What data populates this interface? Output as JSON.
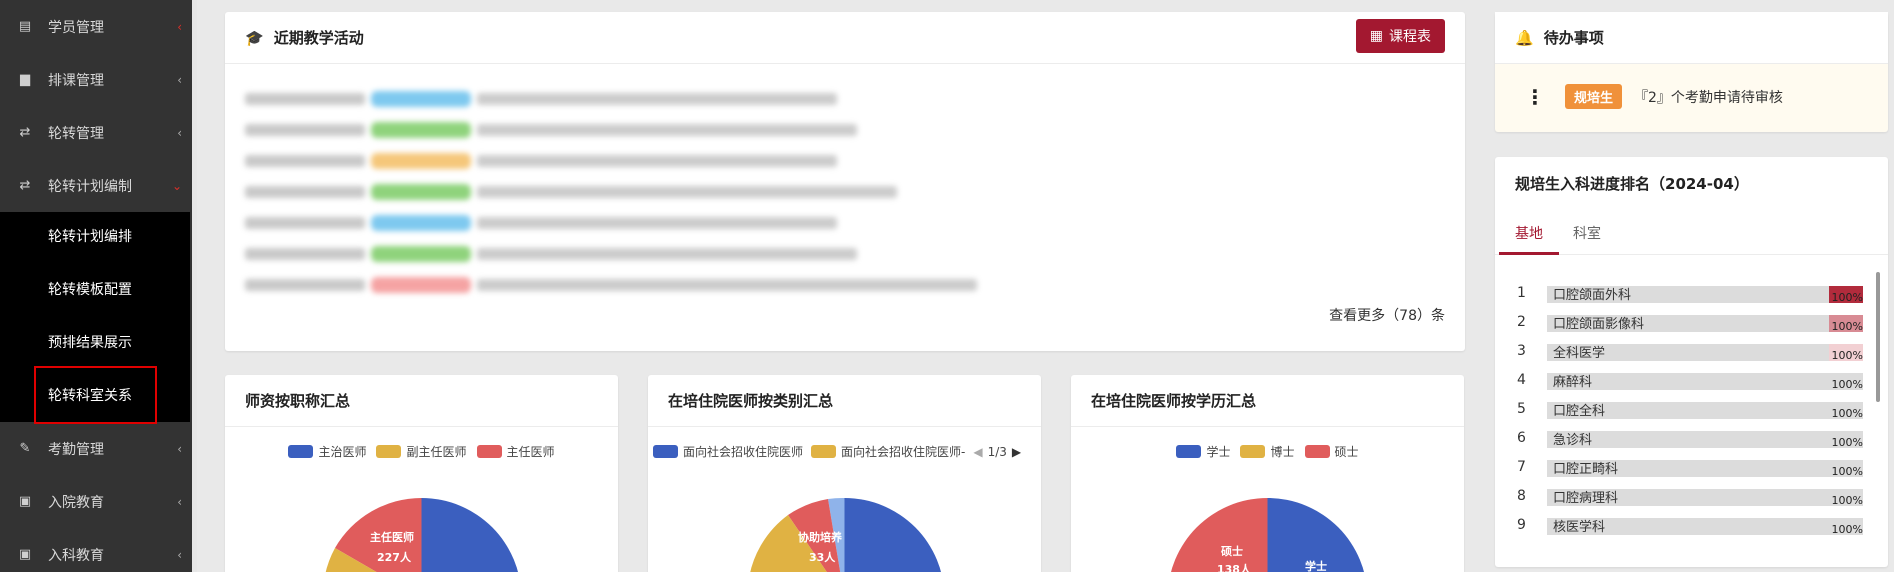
{
  "sidebar": {
    "items": [
      {
        "label": "学员管理",
        "icon": "id-card-icon",
        "arrow_open": true
      },
      {
        "label": "排课管理",
        "icon": "document-icon",
        "arrow_open": false
      },
      {
        "label": "轮转管理",
        "icon": "rotate-icon",
        "arrow_open": false
      },
      {
        "label": "轮转计划编制",
        "icon": "rotate-icon",
        "arrow_open": true
      }
    ],
    "subitems": [
      "轮转计划编排",
      "轮转模板配置",
      "预排结果展示",
      "轮转科室关系"
    ],
    "bottom_items": [
      {
        "label": "考勤管理",
        "icon": "brush-icon"
      },
      {
        "label": "入院教育",
        "icon": "clipboard-icon"
      },
      {
        "label": "入科教育",
        "icon": "clipboard-icon"
      }
    ]
  },
  "recent": {
    "title": "近期教学活动",
    "timetable_label": "课程表",
    "more_label": "查看更多（78）条",
    "blur_colors": [
      "#7ec9ef",
      "#8fd37c",
      "#f5c77a",
      "#8fd37c",
      "#7ec9ef",
      "#8fd37c",
      "#f5a3a3"
    ]
  },
  "todo": {
    "title": "待办事项",
    "badge": "规培生",
    "text": "『2』个考勤申请待审核"
  },
  "ranking": {
    "title": "规培生入科进度排名（2024-04）",
    "tabs": [
      "基地",
      "科室"
    ],
    "rows": [
      {
        "no": "1",
        "name": "口腔颌面外科",
        "pct": "100%",
        "color": "#b22b3c"
      },
      {
        "no": "2",
        "name": "口腔颌面影像科",
        "pct": "100%",
        "color": "#d88b94"
      },
      {
        "no": "3",
        "name": "全科医学",
        "pct": "100%",
        "color": "#f2d0d3"
      },
      {
        "no": "4",
        "name": "麻醉科",
        "pct": "100%",
        "color": "#dcdcdc"
      },
      {
        "no": "5",
        "name": "口腔全科",
        "pct": "100%",
        "color": "#dcdcdc"
      },
      {
        "no": "6",
        "name": "急诊科",
        "pct": "100%",
        "color": "#dcdcdc"
      },
      {
        "no": "7",
        "name": "口腔正畸科",
        "pct": "100%",
        "color": "#dcdcdc"
      },
      {
        "no": "8",
        "name": "口腔病理科",
        "pct": "100%",
        "color": "#dcdcdc"
      },
      {
        "no": "9",
        "name": "核医学科",
        "pct": "100%",
        "color": "#dcdcdc"
      }
    ]
  },
  "charts": {
    "teacher": {
      "title": "师资按职称汇总",
      "legend": [
        {
          "name": "主治医师",
          "color": "#3b5fbf"
        },
        {
          "name": "副主任医师",
          "color": "#e0b243"
        },
        {
          "name": "主任医师",
          "color": "#e05c5c"
        }
      ],
      "slice_label": "主任医师",
      "slice_value": "227人"
    },
    "category": {
      "title": "在培住院医师按类别汇总",
      "legend": [
        {
          "name": "面向社会招收住院医师",
          "color": "#3b5fbf"
        },
        {
          "name": "面向社会招收住院医师-",
          "color": "#e0b243"
        }
      ],
      "pager": "1/3",
      "slice_label": "协助培养",
      "slice_value": "33人"
    },
    "education": {
      "title": "在培住院医师按学历汇总",
      "legend": [
        {
          "name": "学士",
          "color": "#3b5fbf"
        },
        {
          "name": "博士",
          "color": "#e0b243"
        },
        {
          "name": "硕士",
          "color": "#e05c5c"
        }
      ],
      "slice_label": "硕士",
      "slice_value": "138人",
      "slice_label_2": "学士"
    }
  }
}
